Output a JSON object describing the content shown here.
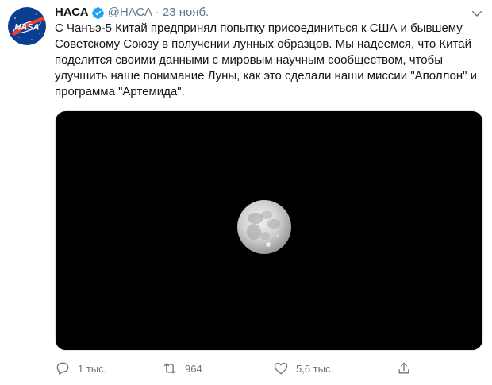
{
  "tweet": {
    "author": {
      "display_name": "НАСА",
      "handle": "@НАСА",
      "verified": true,
      "avatar_icon": "nasa-logo-icon",
      "avatar_text": "NASA"
    },
    "separator": "·",
    "date": "23 нояб.",
    "text": "С Чанъэ-5 Китай предпринял попытку присоединиться к США и бывшему Советскому Союзу в получении лунных образцов. Мы надеемся, что Китай поделится своими данными с мировым научным сообществом, чтобы улучшить наше понимание Луны, как это сделали наши миссии \"Аполлон\" и программа \"Артемида\".",
    "media": {
      "background": "#000000",
      "subject": "moon"
    },
    "actions": {
      "reply": {
        "icon": "reply-icon",
        "count": "1 тыс."
      },
      "retweet": {
        "icon": "retweet-icon",
        "count": "964"
      },
      "like": {
        "icon": "heart-icon",
        "count": "5,6 тыс."
      },
      "share": {
        "icon": "share-icon"
      }
    },
    "colors": {
      "primary_text": "#14171a",
      "secondary_text": "#657786",
      "verified_badge": "#1da1f2",
      "nasa_blue": "#0b3d91",
      "nasa_red": "#fc3d21"
    }
  }
}
